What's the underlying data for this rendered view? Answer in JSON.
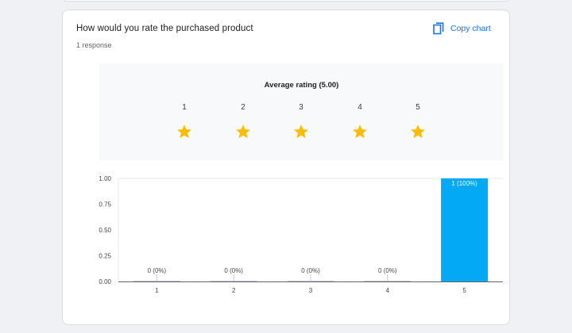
{
  "question": {
    "title": "How would you rate the purchased product",
    "responses": "1 response"
  },
  "toolbar": {
    "copy_label": "Copy chart",
    "copy_icon": "copy-icon"
  },
  "rating": {
    "average_label": "Average rating (5.00)",
    "scale": [
      "1",
      "2",
      "3",
      "4",
      "5"
    ],
    "stars_filled": 5,
    "star_color": "#fbbc04"
  },
  "colors": {
    "accent": "#1a73e8",
    "bar": "#03a9f4"
  },
  "chart_data": {
    "type": "bar",
    "categories": [
      "1",
      "2",
      "3",
      "4",
      "5"
    ],
    "values": [
      0,
      0,
      0,
      0,
      1
    ],
    "data_labels": [
      "0 (0%)",
      "0 (0%)",
      "0 (0%)",
      "0 (0%)",
      "1 (100%)"
    ],
    "yticks": [
      "0.00",
      "0.25",
      "0.50",
      "0.75",
      "1.00"
    ],
    "ylim": [
      0,
      1
    ],
    "grid": false,
    "legend": "none"
  }
}
